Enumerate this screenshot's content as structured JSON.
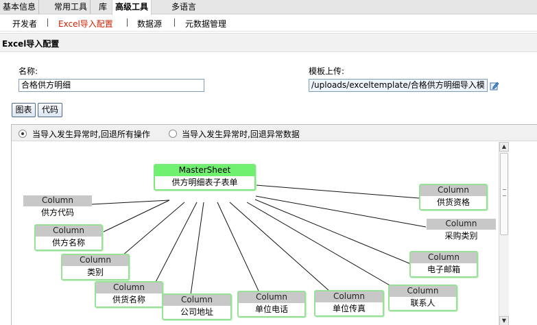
{
  "top_menu": [
    "基本信息",
    "常用工具",
    "库",
    "高级工具",
    "多语言"
  ],
  "sub_menu": [
    "开发者",
    "Excel导入配置",
    "数据源",
    "元数据管理"
  ],
  "page_title": "Excel导入配置",
  "form": {
    "name_label": "名称:",
    "name_value": "合格供方明细",
    "upload_label": "模板上传:",
    "upload_value": "/uploads/exceltemplate/合格供方明细导入模"
  },
  "buttons": {
    "chart": "图表",
    "code": "代码"
  },
  "options": {
    "rollback_all": "当导入发生异常时,回退所有操作",
    "rollback_errors": "当导入发生异常时,回退异常数据",
    "selected": "rollback_all"
  },
  "diagram": {
    "master": {
      "header": "MasterSheet",
      "name": "供方明细表子表单"
    },
    "column_header": "Column",
    "columns": [
      "供方代码",
      "供方名称",
      "类别",
      "供货名称",
      "公司地址",
      "单位电话",
      "单位传真",
      "联系人",
      "电子邮箱",
      "采购类别",
      "供货资格"
    ]
  },
  "colors": {
    "active_submenu": "#cc2200",
    "master_header": "#6ff06f",
    "node_border": "#98e298",
    "column_header": "#c8c8c8"
  },
  "icons": {
    "upload": "edit-upload-icon"
  }
}
